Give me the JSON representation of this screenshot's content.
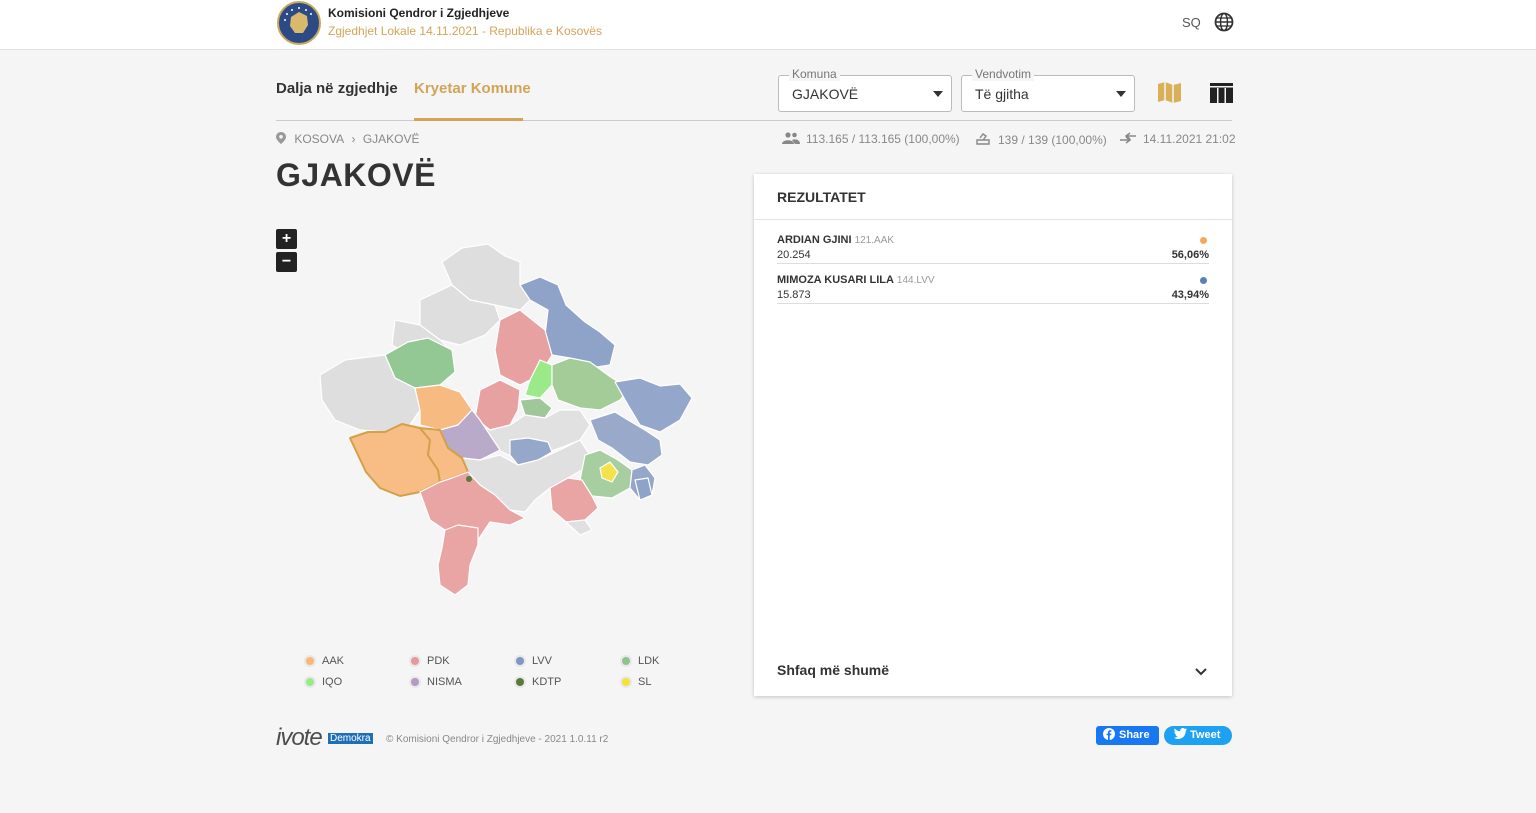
{
  "header": {
    "org_name": "Komisioni Qendror i Zgjedhjeve",
    "subtitle": "Zgjedhjet Lokale 14.11.2021 - Republika e Kosovës",
    "language": "SQ"
  },
  "tabs": [
    {
      "label": "Dalja në zgjedhje",
      "active": false
    },
    {
      "label": "Kryetar Komune",
      "active": true
    }
  ],
  "filters": {
    "komuna": {
      "label": "Komuna",
      "value": "GJAKOVË"
    },
    "vendvotim": {
      "label": "Vendvotim",
      "value": "Të gjitha"
    }
  },
  "breadcrumb": [
    "KOSOVA",
    "GJAKOVË"
  ],
  "stats": {
    "voters": "113.165 / 113.165 (100,00%)",
    "stations": "139 / 139 (100,00%)",
    "updated": "14.11.2021 21:02"
  },
  "page_title": "GJAKOVË",
  "zoom": {
    "in": "+",
    "out": "−"
  },
  "legend": [
    {
      "label": "AAK",
      "color": "#f7b87a"
    },
    {
      "label": "PDK",
      "color": "#e59a9a"
    },
    {
      "label": "LVV",
      "color": "#7f96c4"
    },
    {
      "label": "LDK",
      "color": "#8cc48c"
    },
    {
      "label": "IQO",
      "color": "#9aea8a"
    },
    {
      "label": "NISMA",
      "color": "#b49ac4"
    },
    {
      "label": "KDTP",
      "color": "#5b7a3a"
    },
    {
      "label": "SL",
      "color": "#f2e23a"
    }
  ],
  "results": {
    "title": "REZULTATET",
    "candidates": [
      {
        "name": "ARDIAN GJINI",
        "code": "121.AAK",
        "votes": "20.254",
        "percent": "56,06%",
        "color": "#f7a95a"
      },
      {
        "name": "MIMOZA KUSARI LILA",
        "code": "144.LVV",
        "votes": "15.873",
        "percent": "43,94%",
        "color": "#5b7fb8"
      }
    ],
    "show_more": "Shfaq më shumë"
  },
  "footer": {
    "brand": "ivote",
    "brand_badge": "Demokra",
    "copyright": "© Komisioni Qendror i Zgjedhjeve - 2021 1.0.11 r2",
    "share_label": "Share",
    "tweet_label": "Tweet"
  }
}
